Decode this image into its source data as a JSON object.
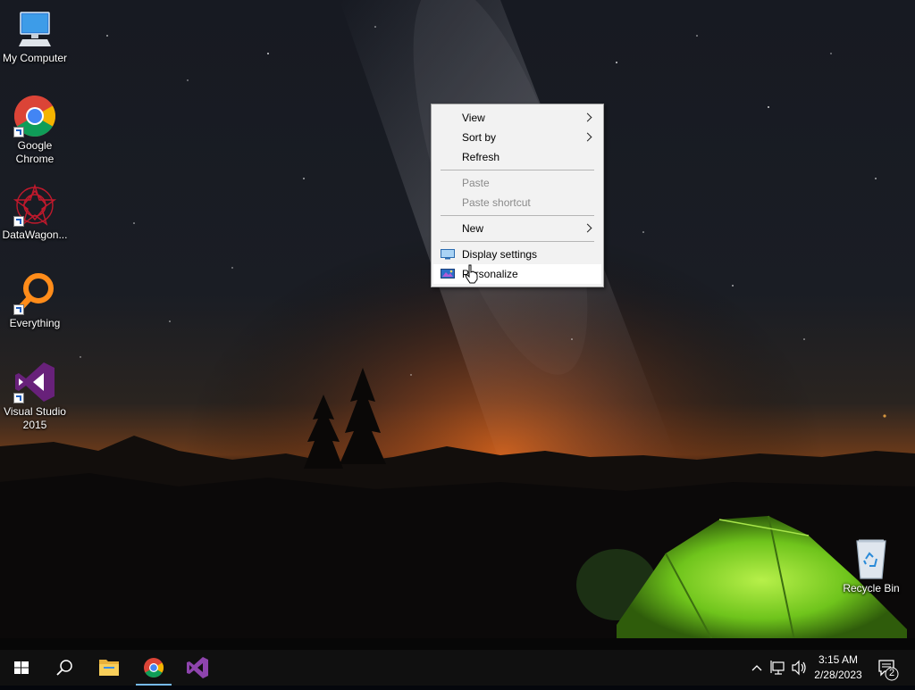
{
  "desktop": {
    "icons": [
      {
        "label": "My Computer"
      },
      {
        "label": "Google Chrome"
      },
      {
        "label": "DataWagon..."
      },
      {
        "label": "Everything"
      },
      {
        "label": "Visual Studio 2015"
      },
      {
        "label": "Recycle Bin"
      }
    ]
  },
  "context_menu": {
    "items": [
      {
        "label": "View",
        "submenu": true
      },
      {
        "label": "Sort by",
        "submenu": true
      },
      {
        "label": "Refresh"
      },
      {
        "label": "Paste",
        "disabled": true
      },
      {
        "label": "Paste shortcut",
        "disabled": true
      },
      {
        "label": "New",
        "submenu": true
      },
      {
        "label": "Display settings",
        "icon": "display-icon"
      },
      {
        "label": "Personalize",
        "icon": "personalize-icon",
        "hovered": true
      }
    ]
  },
  "taskbar": {
    "pinned": [
      {
        "icon": "windows-start-icon"
      },
      {
        "icon": "search-icon"
      },
      {
        "icon": "file-explorer-icon"
      },
      {
        "icon": "chrome-icon",
        "active": true
      },
      {
        "icon": "visual-studio-icon"
      }
    ],
    "tray_icons": [
      "chevron-up-icon",
      "network-icon",
      "volume-icon"
    ],
    "clock": {
      "time": "3:15 AM",
      "date": "2/28/2023"
    },
    "notifications": {
      "count": "2"
    }
  },
  "colors": {
    "menu_bg": "#f2f2f2",
    "taskbar_bg": "#101010",
    "active_indicator": "#76b9ed",
    "tent_green": "#7dd321"
  }
}
